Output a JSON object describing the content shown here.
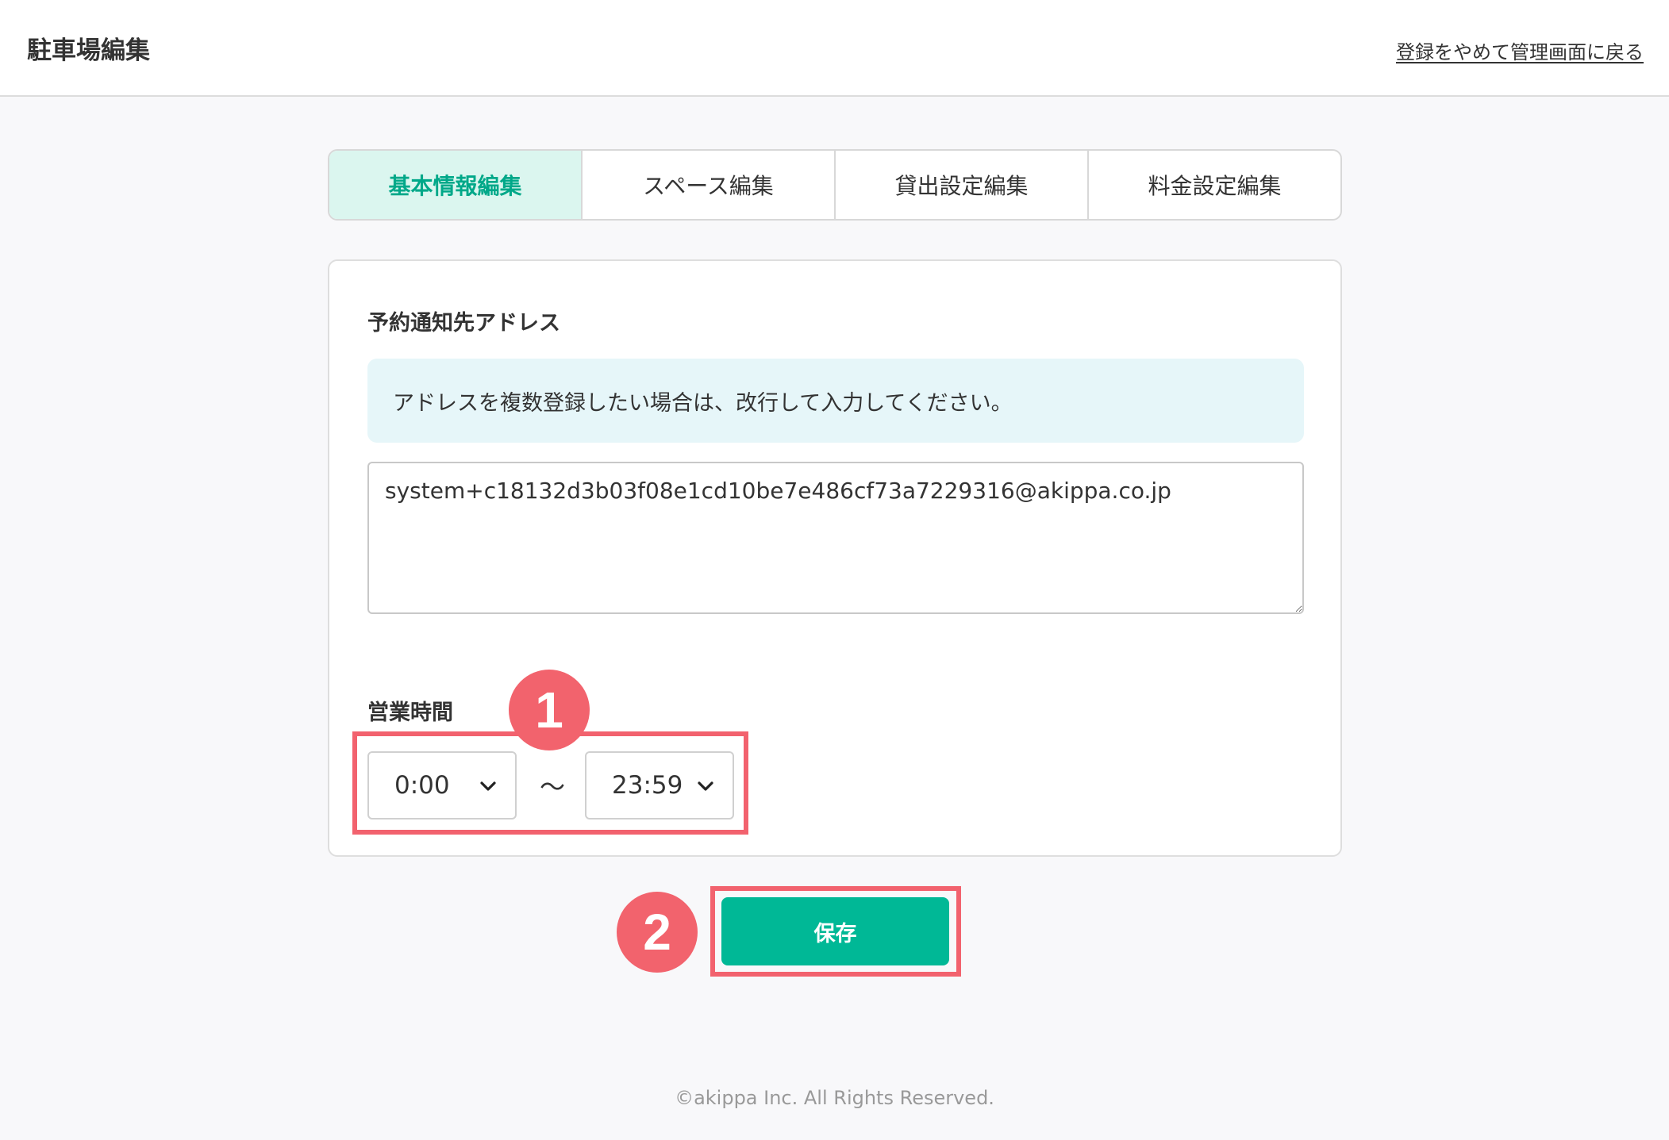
{
  "header": {
    "title": "駐車場編集",
    "back_link": "登録をやめて管理画面に戻る"
  },
  "tabs": [
    {
      "label": "基本情報編集",
      "active": true
    },
    {
      "label": "スペース編集",
      "active": false
    },
    {
      "label": "貸出設定編集",
      "active": false
    },
    {
      "label": "料金設定編集",
      "active": false
    }
  ],
  "address": {
    "label": "予約通知先アドレス",
    "info": "アドレスを複数登録したい場合は、改行して入力してください。",
    "value": "system+c18132d3b03f08e1cd10be7e486cf73a7229316@akippa.co.jp"
  },
  "hours": {
    "label": "営業時間",
    "start": "0:00",
    "separator": "〜",
    "end": "23:59"
  },
  "annotations": {
    "step1": "1",
    "step2": "2",
    "highlight_color": "#f2626e"
  },
  "actions": {
    "save_label": "保存",
    "save_color": "#00b896"
  },
  "footer": {
    "copyright": "©akippa Inc. All Rights Reserved."
  },
  "icons": {
    "select_arrow": "chevron-down-icon"
  }
}
